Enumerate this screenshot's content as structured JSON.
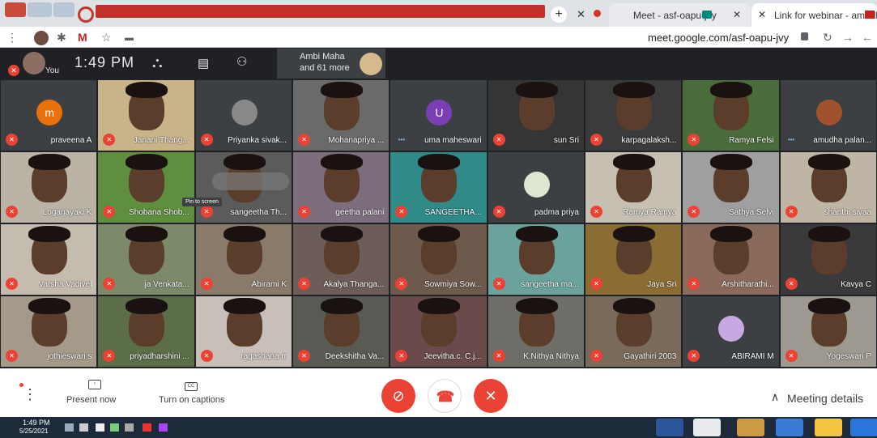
{
  "browser": {
    "tabs": [
      {
        "label": "Link for webinar - amudha.palan",
        "active": false
      },
      {
        "label": "Meet - asf-oapu-jvy",
        "active": true
      }
    ],
    "url": "meet.google.com/asf-oapu-jvy"
  },
  "top": {
    "you_label": "You",
    "time": "1:49 PM",
    "presenter_name": "Ambi Maha",
    "presenter_more": "and 61 more"
  },
  "tiles": [
    {
      "name": "amudha palan...",
      "type": "avatar",
      "color": "#a0522d",
      "speaking": true
    },
    {
      "name": "Ramya Felsi",
      "type": "video",
      "bg": "#4a6b3a"
    },
    {
      "name": "karpagalaksh...",
      "type": "video",
      "bg": "#3b3b3b"
    },
    {
      "name": "sun Sri",
      "type": "video",
      "bg": "#353535"
    },
    {
      "name": "uma maheswari",
      "type": "letter",
      "letter": "U",
      "color": "#7b3fb5",
      "speaking": true
    },
    {
      "name": "Mohanapriya ...",
      "type": "video",
      "bg": "#6a6a6a"
    },
    {
      "name": "Priyanka sivak...",
      "type": "avatar",
      "color": "#888888"
    },
    {
      "name": "Janani Thang...",
      "type": "video",
      "bg": "#c9b48a"
    },
    {
      "name": "praveena A",
      "type": "letter",
      "letter": "m",
      "color": "#e8710a"
    },
    {
      "name": "shanthi sivaa",
      "type": "video",
      "bg": "#bfb5a5"
    },
    {
      "name": "Sathya Selvi",
      "type": "video",
      "bg": "#9f9f9f"
    },
    {
      "name": "Ramya Ramya",
      "type": "video",
      "bg": "#c7c0b2"
    },
    {
      "name": "padma priya",
      "type": "avatar",
      "color": "#dfe6d0"
    },
    {
      "name": "SANGEETHA...",
      "type": "video",
      "bg": "#2f8a88"
    },
    {
      "name": "geetha palani",
      "type": "video",
      "bg": "#7d6e7e"
    },
    {
      "name": "sangeetha Th...",
      "type": "video",
      "bg": "#5b5b5b"
    },
    {
      "name": "Shobana Shob...",
      "type": "video",
      "bg": "#5f8f3e"
    },
    {
      "name": "Loganayaki K",
      "type": "video",
      "bg": "#bbb4a6"
    },
    {
      "name": "Kavya C",
      "type": "video",
      "bg": "#3a3a3a"
    },
    {
      "name": "Arshitharathi...",
      "type": "video",
      "bg": "#8a6a5a"
    },
    {
      "name": "Jaya Sri",
      "type": "video",
      "bg": "#8b6d33"
    },
    {
      "name": "sangeetha ma...",
      "type": "video",
      "bg": "#6aa39b"
    },
    {
      "name": "Sowmiya Sow...",
      "type": "video",
      "bg": "#6e5a4d"
    },
    {
      "name": "Akalya Thanga...",
      "type": "video",
      "bg": "#6d5d58"
    },
    {
      "name": "Abirami K",
      "type": "video",
      "bg": "#8a7a6a"
    },
    {
      "name": "ja Venkata...",
      "type": "video",
      "bg": "#7c8a6a"
    },
    {
      "name": "Varsha Vadivel",
      "type": "video",
      "bg": "#c4bcae"
    },
    {
      "name": "Yogeswari P",
      "type": "video",
      "bg": "#9d9890"
    },
    {
      "name": "ABIRAMI M",
      "type": "avatar",
      "color": "#c8a8e0"
    },
    {
      "name": "Gayathiri 2003",
      "type": "video",
      "bg": "#7a6a5a"
    },
    {
      "name": "K.Nithya Nithya",
      "type": "video",
      "bg": "#6e6d68"
    },
    {
      "name": "Jeevitha.c. C.j...",
      "type": "video",
      "bg": "#6a4a4a"
    },
    {
      "name": "Deekshitha Va...",
      "type": "video",
      "bg": "#5a5a54"
    },
    {
      "name": "ragashana rr",
      "type": "video",
      "bg": "#c7bfb8"
    },
    {
      "name": "priyadharshini ...",
      "type": "video",
      "bg": "#5b6e48"
    },
    {
      "name": "jothieswari s",
      "type": "video",
      "bg": "#a59a8a"
    }
  ],
  "pin_tooltip": "Pin to screen",
  "controls": {
    "present_label": "Present now",
    "captions_label": "Turn on captions",
    "meeting_details": "Meeting details"
  },
  "taskbar": {
    "time": "1:49 PM",
    "date": "5/25/2021"
  },
  "colors": {
    "accent_red": "#ea4335",
    "meet_bg": "#202124",
    "speaking_blue": "#8ab4f8"
  }
}
